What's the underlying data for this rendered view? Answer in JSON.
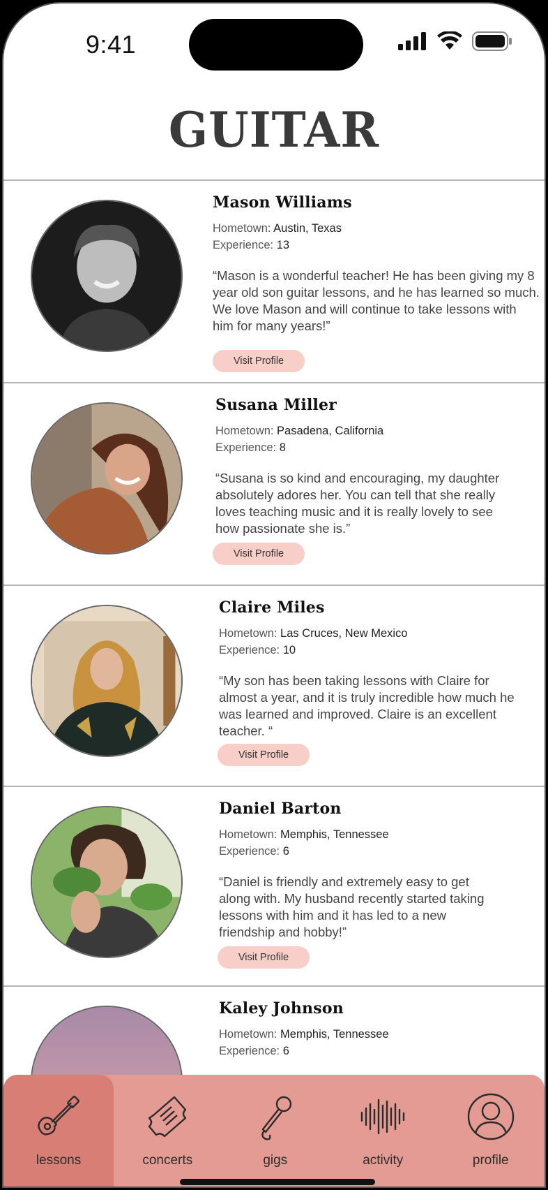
{
  "status_bar": {
    "time": "9:41"
  },
  "header": {
    "title": "GUITAR"
  },
  "labels": {
    "hometown": "Hometown:",
    "experience": "Experience:"
  },
  "teachers": [
    {
      "name": "Mason Williams",
      "hometown": "Austin, Texas",
      "experience": "13",
      "review": "“Mason is a wonderful teacher! He has been giving my 8 year old son guitar lessons, and he has learned so much. We love Mason and will continue to take lessons with him for many years!”",
      "button": "Visit Profile"
    },
    {
      "name": "Susana Miller",
      "hometown": "Pasadena, California",
      "experience": "8",
      "review": "“Susana is so kind and encouraging, my daughter absolutely adores her. You can tell that she really loves teaching music and it is really lovely to see how passionate she is.”",
      "button": "Visit Profile"
    },
    {
      "name": "Claire Miles",
      "hometown": "Las Cruces, New Mexico",
      "experience": "10",
      "review": "“My son has been taking lessons with Claire for almost a year, and it is  truly incredible how much he was learned and improved. Claire is an excellent teacher. “",
      "button": "Visit Profile"
    },
    {
      "name": "Daniel Barton",
      "hometown": "Memphis, Tennessee",
      "experience": "6",
      "review": "“Daniel is friendly and extremely easy to get along with. My husband recently started taking lessons with him and it has led to a new friendship and hobby!”",
      "button": "Visit Profile"
    },
    {
      "name": "Kaley Johnson",
      "hometown": "Memphis, Tennessee",
      "experience": "6",
      "review": "",
      "button": ""
    }
  ],
  "tabs": [
    {
      "label": "lessons",
      "icon": "guitar-icon",
      "active": true
    },
    {
      "label": "concerts",
      "icon": "ticket-icon",
      "active": false
    },
    {
      "label": "gigs",
      "icon": "microphone-icon",
      "active": false
    },
    {
      "label": "activity",
      "icon": "soundwave-icon",
      "active": false
    },
    {
      "label": "profile",
      "icon": "user-icon",
      "active": false
    }
  ],
  "colors": {
    "tab_bar": "#e39b93",
    "tab_active": "#d97e74",
    "button": "#f8cfc8"
  }
}
